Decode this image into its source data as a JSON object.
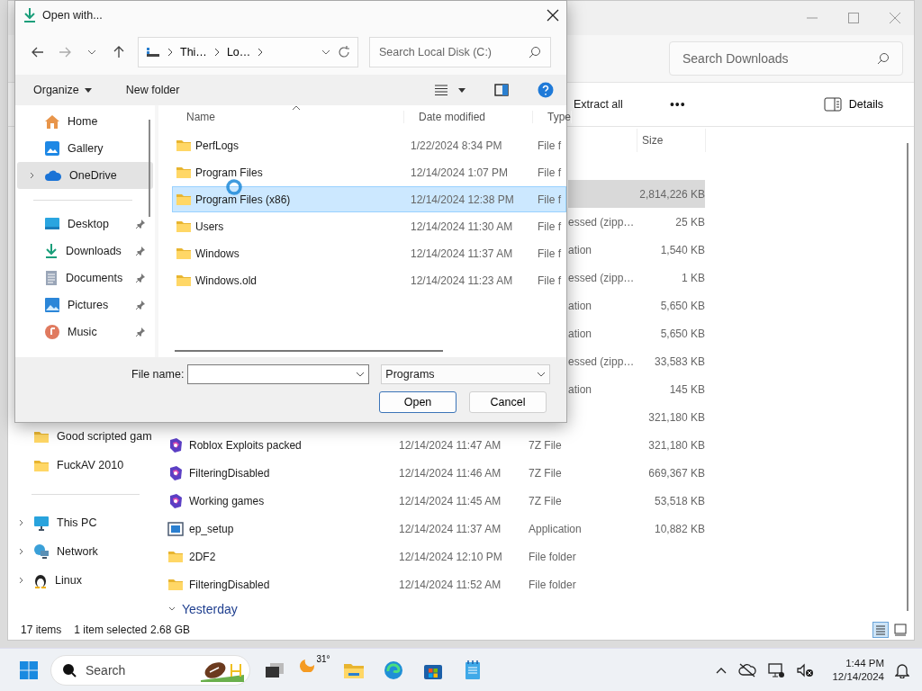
{
  "explorer": {
    "search": {
      "placeholder": "Search Downloads"
    },
    "toolbar": {
      "extract": "Extract all",
      "more": "•••",
      "details": "Details"
    },
    "size_header": "Size",
    "nav": [
      {
        "label": "Good scripted gam",
        "kind": "folder"
      },
      {
        "label": "FuckAV 2010",
        "kind": "folder"
      },
      {
        "label": "This PC",
        "kind": "pc",
        "expanded": false
      },
      {
        "label": "Network",
        "kind": "network",
        "expanded": false
      },
      {
        "label": "Linux",
        "kind": "linux",
        "expanded": false
      }
    ],
    "rows": [
      {
        "kind": "hidden",
        "size": "2,814,226 KB",
        "selected": true
      },
      {
        "kind": "hidden",
        "type": "essed (zipp…",
        "size": "25 KB",
        "selected": false
      },
      {
        "kind": "hidden",
        "type": "ation",
        "size": "1,540 KB",
        "selected": false
      },
      {
        "kind": "hidden",
        "type": "essed (zipp…",
        "size": "1 KB",
        "selected": false
      },
      {
        "kind": "hidden",
        "type": "ation",
        "size": "5,650 KB",
        "selected": false
      },
      {
        "kind": "hidden",
        "type": "ation",
        "size": "5,650 KB",
        "selected": false
      },
      {
        "kind": "hidden",
        "type": "essed (zipp…",
        "size": "33,583 KB",
        "selected": false
      },
      {
        "kind": "hidden",
        "type": "ation",
        "size": "145 KB",
        "selected": false
      },
      {
        "kind": "hidden",
        "size": "321,180 KB",
        "selected": false
      },
      {
        "kind": "archive",
        "name": "Roblox Exploits packed",
        "date": "12/14/2024 11:47 AM",
        "type": "7Z File",
        "size": "321,180 KB",
        "selected": false
      },
      {
        "kind": "archive",
        "name": "FilteringDisabled",
        "date": "12/14/2024 11:46 AM",
        "type": "7Z File",
        "size": "669,367 KB",
        "selected": false
      },
      {
        "kind": "archive",
        "name": "Working games",
        "date": "12/14/2024 11:45 AM",
        "type": "7Z File",
        "size": "53,518 KB",
        "selected": false
      },
      {
        "kind": "app",
        "name": "ep_setup",
        "date": "12/14/2024 11:37 AM",
        "type": "Application",
        "size": "10,882 KB",
        "selected": false
      },
      {
        "kind": "folder",
        "name": "2DF2",
        "date": "12/14/2024 12:10 PM",
        "type": "File folder",
        "selected": false
      },
      {
        "kind": "folder",
        "name": "FilteringDisabled",
        "date": "12/14/2024 11:52 AM",
        "type": "File folder",
        "selected": false
      }
    ],
    "group": "Yesterday",
    "status": {
      "count": "17 items",
      "selection": "1 item selected",
      "size": "2.68 GB"
    }
  },
  "dialog": {
    "title": "Open with...",
    "address": [
      "Thi…",
      "Lo…"
    ],
    "search": {
      "placeholder": "Search Local Disk (C:)"
    },
    "commands": {
      "organize": "Organize",
      "new_folder": "New folder"
    },
    "nav": [
      {
        "label": "Home",
        "kind": "home",
        "pinned": false,
        "selected": false
      },
      {
        "label": "Gallery",
        "kind": "gallery",
        "pinned": false,
        "selected": false
      },
      {
        "label": "OneDrive",
        "kind": "onedrive",
        "pinned": false,
        "selected": true,
        "expanded": false
      },
      {
        "label": "Desktop",
        "kind": "desktop",
        "pinned": true,
        "selected": false
      },
      {
        "label": "Downloads",
        "kind": "downloads",
        "pinned": true,
        "selected": false
      },
      {
        "label": "Documents",
        "kind": "documents",
        "pinned": true,
        "selected": false
      },
      {
        "label": "Pictures",
        "kind": "pictures",
        "pinned": true,
        "selected": false
      },
      {
        "label": "Music",
        "kind": "music",
        "pinned": true,
        "selected": false
      }
    ],
    "columns": [
      "Name",
      "Date modified",
      "Type"
    ],
    "files": [
      {
        "name": "PerfLogs",
        "date": "1/22/2024 8:34 PM",
        "type": "File f",
        "selected": false
      },
      {
        "name": "Program Files",
        "date": "12/14/2024 1:07 PM",
        "type": "File f",
        "selected": false
      },
      {
        "name": "Program Files (x86)",
        "date": "12/14/2024 12:38 PM",
        "type": "File f",
        "selected": true
      },
      {
        "name": "Users",
        "date": "12/14/2024 11:30 AM",
        "type": "File f",
        "selected": false
      },
      {
        "name": "Windows",
        "date": "12/14/2024 11:37 AM",
        "type": "File f",
        "selected": false
      },
      {
        "name": "Windows.old",
        "date": "12/14/2024 11:23 AM",
        "type": "File f",
        "selected": false
      }
    ],
    "file_name_label": "File name:",
    "filter": "Programs",
    "buttons": {
      "open": "Open",
      "cancel": "Cancel"
    }
  },
  "taskbar": {
    "search": {
      "placeholder": "Search"
    },
    "temperature": "31°",
    "time": "1:44 PM",
    "date": "12/14/2024"
  }
}
